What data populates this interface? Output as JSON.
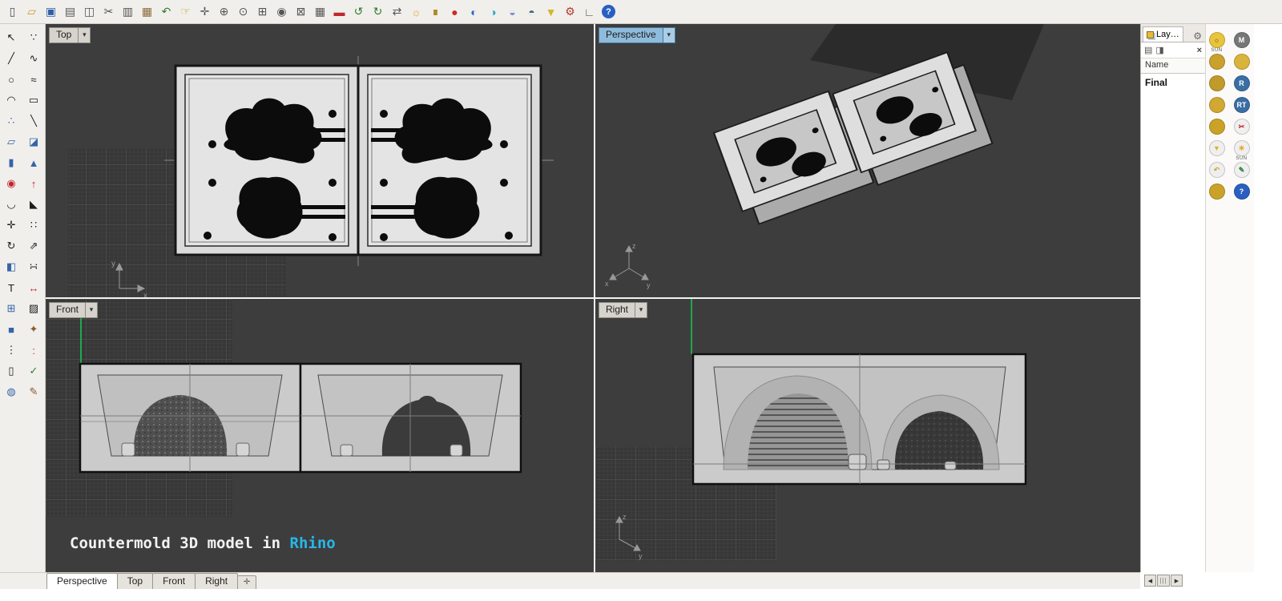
{
  "ui": {
    "dropdown_glyph": "▾"
  },
  "colors": {
    "toolbar_bg": "#f1efec",
    "viewport_bg": "#3d3d3d",
    "divider": "#f2f2f2",
    "active_chip_bg": "#8fbcdc",
    "caption_text": "#f2f2f2",
    "caption_accent_cyan": "#29b6ea",
    "axis_green": "#1ea84e",
    "mold_light_gray": "#dbdbdb",
    "mold_black": "#0c0c0c"
  },
  "toolbar": {
    "icons": [
      {
        "name": "new-file-icon",
        "glyph": "▯",
        "color": "#49505a"
      },
      {
        "name": "open-folder-icon",
        "glyph": "▱",
        "color": "#d09a32"
      },
      {
        "name": "save-icon",
        "glyph": "▣",
        "color": "#2f5fa8"
      },
      {
        "name": "print-icon",
        "glyph": "▤",
        "color": "#555"
      },
      {
        "name": "copy-to-clipboard-icon",
        "glyph": "◫",
        "color": "#555"
      },
      {
        "name": "cut-icon",
        "glyph": "✂",
        "color": "#555"
      },
      {
        "name": "copy-icon",
        "glyph": "▥",
        "color": "#555"
      },
      {
        "name": "paste-icon",
        "glyph": "▦",
        "color": "#8a6b3a"
      },
      {
        "name": "undo-icon",
        "glyph": "↶",
        "color": "#2e7d32"
      },
      {
        "name": "pan-hand-icon",
        "glyph": "☞",
        "color": "#c9a227"
      },
      {
        "name": "move-icon",
        "glyph": "✛",
        "color": "#555"
      },
      {
        "name": "zoom-in-icon",
        "glyph": "⊕",
        "color": "#555"
      },
      {
        "name": "zoom-dynamic-icon",
        "glyph": "⊙",
        "color": "#555"
      },
      {
        "name": "zoom-window-icon",
        "glyph": "⊞",
        "color": "#555"
      },
      {
        "name": "zoom-selected-icon",
        "glyph": "◉",
        "color": "#555"
      },
      {
        "name": "zoom-extents-icon",
        "glyph": "⊠",
        "color": "#555"
      },
      {
        "name": "grid-icon",
        "glyph": "▦",
        "color": "#555"
      },
      {
        "name": "named-view-car-icon",
        "glyph": "▬",
        "color": "#c1272d"
      },
      {
        "name": "undo-view-icon",
        "glyph": "↺",
        "color": "#2e7d32"
      },
      {
        "name": "redo-view-icon",
        "glyph": "↻",
        "color": "#2e7d32"
      },
      {
        "name": "cycle-view-icon",
        "glyph": "⇄",
        "color": "#555"
      },
      {
        "name": "light-icon",
        "glyph": "☼",
        "color": "#e0a62a"
      },
      {
        "name": "lock-icon",
        "glyph": "∎",
        "color": "#b08a2a"
      },
      {
        "name": "render-red-ball-icon",
        "glyph": "●",
        "color": "#cc2a2a"
      },
      {
        "name": "render-ball-icon",
        "glyph": "◐",
        "color": "#2a66cc"
      },
      {
        "name": "shaded-ball-icon",
        "glyph": "◑",
        "color": "#2aa6cc"
      },
      {
        "name": "ghosted-ball-icon",
        "glyph": "◒",
        "color": "#7a8fcc"
      },
      {
        "name": "xray-ball-icon",
        "glyph": "◓",
        "color": "#4a6a8a"
      },
      {
        "name": "filter-funnel-icon",
        "glyph": "▼",
        "color": "#d4b62a"
      },
      {
        "name": "settings-gear-icon",
        "glyph": "⚙",
        "color": "#b03a2e"
      },
      {
        "name": "cplane-icon",
        "glyph": "∟",
        "color": "#555"
      },
      {
        "name": "help-icon",
        "glyph": "?",
        "color": "#ffffff",
        "cls": "help"
      }
    ]
  },
  "palette": {
    "icons": [
      {
        "name": "select-arrow-tool",
        "glyph": "↖",
        "color": "#1c1c1c"
      },
      {
        "name": "lasso-select-tool",
        "glyph": "∵",
        "color": "#1c1c1c"
      },
      {
        "name": "polyline-tool",
        "glyph": "╱",
        "color": "#1c1c1c"
      },
      {
        "name": "helix-tool",
        "glyph": "∿",
        "color": "#1c1c1c"
      },
      {
        "name": "circle-tool",
        "glyph": "○",
        "color": "#1c1c1c"
      },
      {
        "name": "freeform-curve-tool",
        "glyph": "≈",
        "color": "#1c1c1c"
      },
      {
        "name": "arc-tool",
        "glyph": "◠",
        "color": "#1c1c1c"
      },
      {
        "name": "rectangle-tool",
        "glyph": "▭",
        "color": "#1c1c1c"
      },
      {
        "name": "curve-points-tool",
        "glyph": "∴",
        "color": "#3565a8"
      },
      {
        "name": "line-tool",
        "glyph": "╲",
        "color": "#1c1c1c"
      },
      {
        "name": "surface-tool",
        "glyph": "▱",
        "color": "#3565a8"
      },
      {
        "name": "loft-tool",
        "glyph": "◪",
        "color": "#3565a8"
      },
      {
        "name": "cylinder-tool",
        "glyph": "▮",
        "color": "#3565a8"
      },
      {
        "name": "cone-tool",
        "glyph": "▲",
        "color": "#3565a8"
      },
      {
        "name": "boolean-tool",
        "glyph": "◉",
        "color": "#c1272d"
      },
      {
        "name": "extrude-tool",
        "glyph": "↑",
        "color": "#c1272d"
      },
      {
        "name": "fillet-tool",
        "glyph": "◡",
        "color": "#1c1c1c"
      },
      {
        "name": "chamfer-tool",
        "glyph": "◣",
        "color": "#1c1c1c"
      },
      {
        "name": "move-tool",
        "glyph": "✛",
        "color": "#1c1c1c"
      },
      {
        "name": "copy-tool",
        "glyph": "∷",
        "color": "#1c1c1c"
      },
      {
        "name": "rotate-tool",
        "glyph": "↻",
        "color": "#1c1c1c"
      },
      {
        "name": "scale-tool",
        "glyph": "⇗",
        "color": "#1c1c1c"
      },
      {
        "name": "mirror-tool",
        "glyph": "◧",
        "color": "#3565a8"
      },
      {
        "name": "array-tool",
        "glyph": "∺",
        "color": "#1c1c1c"
      },
      {
        "name": "text-tool",
        "glyph": "T",
        "color": "#1c1c1c"
      },
      {
        "name": "dimension-tool",
        "glyph": "↔",
        "color": "#c1272d"
      },
      {
        "name": "block-tool",
        "glyph": "⊞",
        "color": "#3565a8"
      },
      {
        "name": "hatch-tool",
        "glyph": "▨",
        "color": "#1c1c1c"
      },
      {
        "name": "cube-tool",
        "glyph": "■",
        "color": "#3565a8"
      },
      {
        "name": "hammer-tool",
        "glyph": "✦",
        "color": "#8a5a2a"
      },
      {
        "name": "point-grid-tool",
        "glyph": "⋮",
        "color": "#1c1c1c"
      },
      {
        "name": "point-cloud-tool",
        "glyph": ":",
        "color": "#c1272d"
      },
      {
        "name": "sheet-tool",
        "glyph": "▯",
        "color": "#1c1c1c"
      },
      {
        "name": "check-tool",
        "glyph": "✓",
        "color": "#2e7d32"
      },
      {
        "name": "sphere-tool",
        "glyph": "◍",
        "color": "#3565a8"
      },
      {
        "name": "pencil-tool",
        "glyph": "✎",
        "color": "#8a5a2a"
      }
    ]
  },
  "viewports": {
    "top": {
      "label": "Top"
    },
    "perspective": {
      "label": "Perspective"
    },
    "front": {
      "label": "Front",
      "caption_plain": "Countermold 3D model in ",
      "caption_highlight": "Rhino"
    },
    "right": {
      "label": "Right"
    },
    "axes": {
      "x": "x",
      "y": "y",
      "z": "z"
    }
  },
  "layers_panel": {
    "tab_label": "Lay…",
    "gear_glyph": "⚙",
    "new_layer_glyph": "▤",
    "sublayer_glyph": "◨",
    "close_glyph": "×",
    "name_header": "Name",
    "layers": [
      {
        "name": "Final"
      }
    ]
  },
  "right_strip": {
    "items": [
      {
        "name": "sun-settings-icon",
        "glyph": "☼",
        "bg": "#e9c43c",
        "fg": "#6b5200",
        "label": "SUN"
      },
      {
        "name": "material-editor-icon",
        "glyph": "M",
        "bg": "#777777",
        "fg": "#ffffff"
      },
      {
        "name": "render-ball-gold-icon",
        "glyph": "",
        "bg": "#caa02e",
        "fg": "#ffffff"
      },
      {
        "name": "texture-ball-icon",
        "glyph": "",
        "bg": "#d8b43c",
        "fg": "#ffffff"
      },
      {
        "name": "environment-ball-icon",
        "glyph": "",
        "bg": "#c09a2a",
        "fg": "#ffffff"
      },
      {
        "name": "render-button-icon",
        "glyph": "R",
        "bg": "#3a6ea5",
        "fg": "#ffffff"
      },
      {
        "name": "ground-plane-icon",
        "glyph": "",
        "bg": "#d0a832",
        "fg": "#ffffff"
      },
      {
        "name": "render-in-window-icon",
        "glyph": "RT",
        "bg": "#3a6ea5",
        "fg": "#ffffff"
      },
      {
        "name": "gold-ball-icon",
        "glyph": "",
        "bg": "#c9a227",
        "fg": "#ffffff"
      },
      {
        "name": "snapshot-scissors-icon",
        "glyph": "✂",
        "bg": "#efefef",
        "fg": "#c1272d"
      },
      {
        "name": "filter-funnel-small-icon",
        "glyph": "▼",
        "bg": "#efefef",
        "fg": "#d4b62a"
      },
      {
        "name": "sun-study-icon",
        "glyph": "☀",
        "bg": "#efefef",
        "fg": "#e8a020",
        "label": "SUN"
      },
      {
        "name": "undo-arrow-icon",
        "glyph": "↶",
        "bg": "#efefef",
        "fg": "#caa53a"
      },
      {
        "name": "annotate-pencil-icon",
        "glyph": "✎",
        "bg": "#efefef",
        "fg": "#2e7d32"
      },
      {
        "name": "gold-ball2-icon",
        "glyph": "",
        "bg": "#c9a227",
        "fg": "#ffffff"
      },
      {
        "name": "help-button-icon",
        "glyph": "?",
        "bg": "#2a5fc1",
        "fg": "#ffffff"
      }
    ]
  },
  "bottom": {
    "tabs": [
      {
        "name": "tab-perspective",
        "label": "Perspective",
        "state": "active"
      },
      {
        "name": "tab-top",
        "label": "Top"
      },
      {
        "name": "tab-front",
        "label": "Front"
      },
      {
        "name": "tab-right",
        "label": "Right"
      }
    ],
    "add_glyph": "✛",
    "scroll_left": "◀",
    "scroll_right": "▶",
    "scroll_grip": "|||"
  }
}
